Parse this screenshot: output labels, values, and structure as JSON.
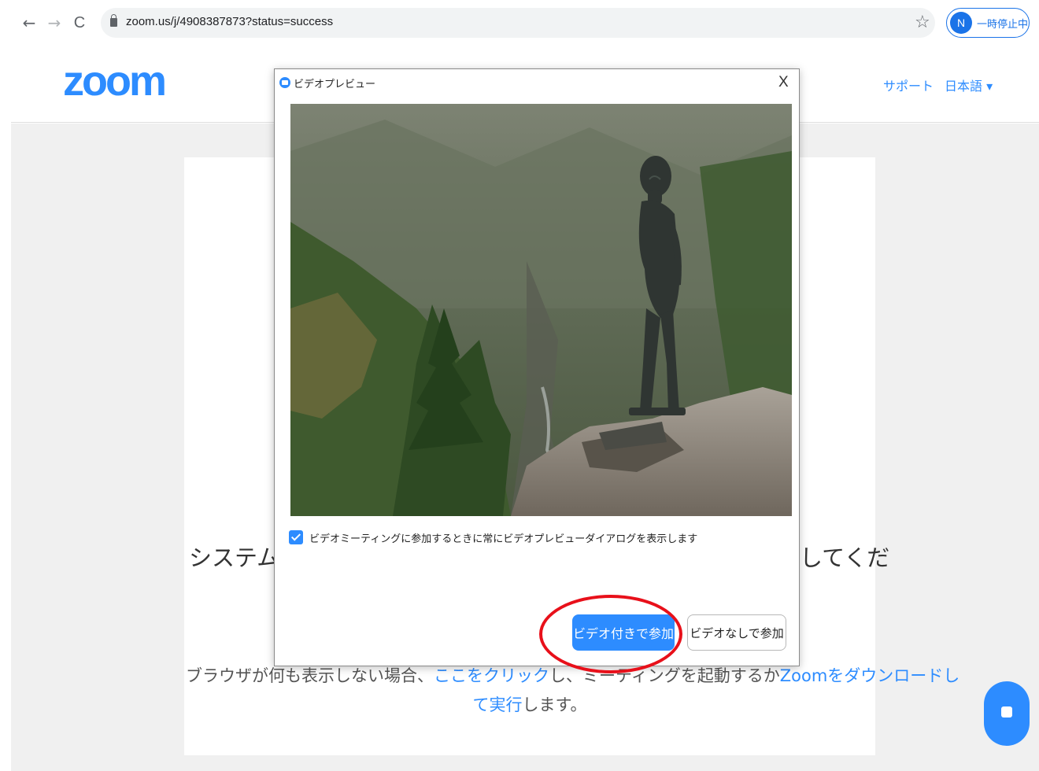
{
  "browser": {
    "url": "zoom.us/j/4908387873?status=success",
    "profile_initial": "N",
    "profile_label": "一時停止中",
    "back_glyph": "←",
    "forward_glyph": "→",
    "reload_glyph": "C",
    "star_glyph": "☆"
  },
  "header": {
    "logo": "zoom",
    "support": "サポート",
    "language": "日本語 ▾"
  },
  "page": {
    "launch_text_start": "システムダ",
    "launch_text_end": "してくだ",
    "help_prefix": "ブラウザが何も表示しない場合、",
    "help_link_click": "ここをクリック",
    "help_middle": "し、ミーティングを起動するか",
    "help_link_download": "Zoomをダウンロードし",
    "help_link_run": "て実行",
    "help_suffix": "します。"
  },
  "dialog": {
    "title": "ビデオプレビュー",
    "close": "X",
    "checkbox_label": "ビデオミーティングに参加するときに常にビデオプレビューダイアログを表示します",
    "checkbox_checked": true,
    "join_with_video": "ビデオ付きで参加",
    "join_without_video": "ビデオなしで参加"
  },
  "colors": {
    "zoom_blue": "#2d8cff",
    "highlight_red": "#e8101a",
    "page_background": "#f0f0f0"
  }
}
